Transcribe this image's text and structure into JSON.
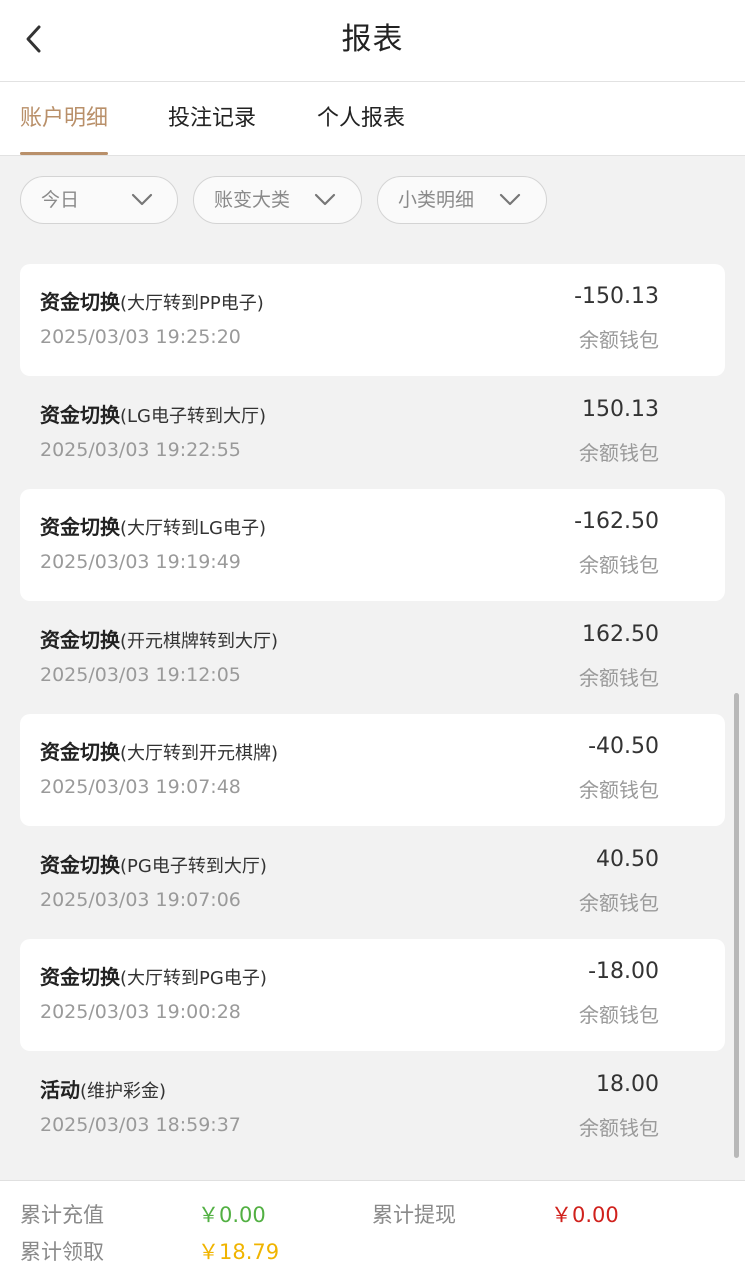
{
  "header": {
    "title": "报表",
    "back_icon": "chevron-left-icon"
  },
  "tabs": [
    {
      "label": "账户明细",
      "active": true
    },
    {
      "label": "投注记录",
      "active": false
    },
    {
      "label": "个人报表",
      "active": false
    }
  ],
  "filters": [
    {
      "label": "今日"
    },
    {
      "label": "账变大类"
    },
    {
      "label": "小类明细"
    }
  ],
  "records": [
    {
      "title": "资金切换",
      "detail": "(大厅转到PP电子)",
      "time": "2025/03/03 19:25:20",
      "amount": "-150.13",
      "wallet": "余额钱包"
    },
    {
      "title": "资金切换",
      "detail": "(LG电子转到大厅)",
      "time": "2025/03/03 19:22:55",
      "amount": "150.13",
      "wallet": "余额钱包"
    },
    {
      "title": "资金切换",
      "detail": "(大厅转到LG电子)",
      "time": "2025/03/03 19:19:49",
      "amount": "-162.50",
      "wallet": "余额钱包"
    },
    {
      "title": "资金切换",
      "detail": "(开元棋牌转到大厅)",
      "time": "2025/03/03 19:12:05",
      "amount": "162.50",
      "wallet": "余额钱包"
    },
    {
      "title": "资金切换",
      "detail": "(大厅转到开元棋牌)",
      "time": "2025/03/03 19:07:48",
      "amount": "-40.50",
      "wallet": "余额钱包"
    },
    {
      "title": "资金切换",
      "detail": "(PG电子转到大厅)",
      "time": "2025/03/03 19:07:06",
      "amount": "40.50",
      "wallet": "余额钱包"
    },
    {
      "title": "资金切换",
      "detail": "(大厅转到PG电子)",
      "time": "2025/03/03 19:00:28",
      "amount": "-18.00",
      "wallet": "余额钱包"
    },
    {
      "title": "活动",
      "detail": "(维护彩金)",
      "time": "2025/03/03 18:59:37",
      "amount": "18.00",
      "wallet": "余额钱包"
    }
  ],
  "summary": {
    "deposit_label": "累计充值",
    "deposit_value": "￥0.00",
    "withdraw_label": "累计提现",
    "withdraw_value": "￥0.00",
    "claim_label": "累计领取",
    "claim_value": "￥18.79"
  },
  "colors": {
    "accent": "#b9906a",
    "deposit": "#52b043",
    "withdraw": "#d0211c",
    "claim": "#f0b400"
  }
}
